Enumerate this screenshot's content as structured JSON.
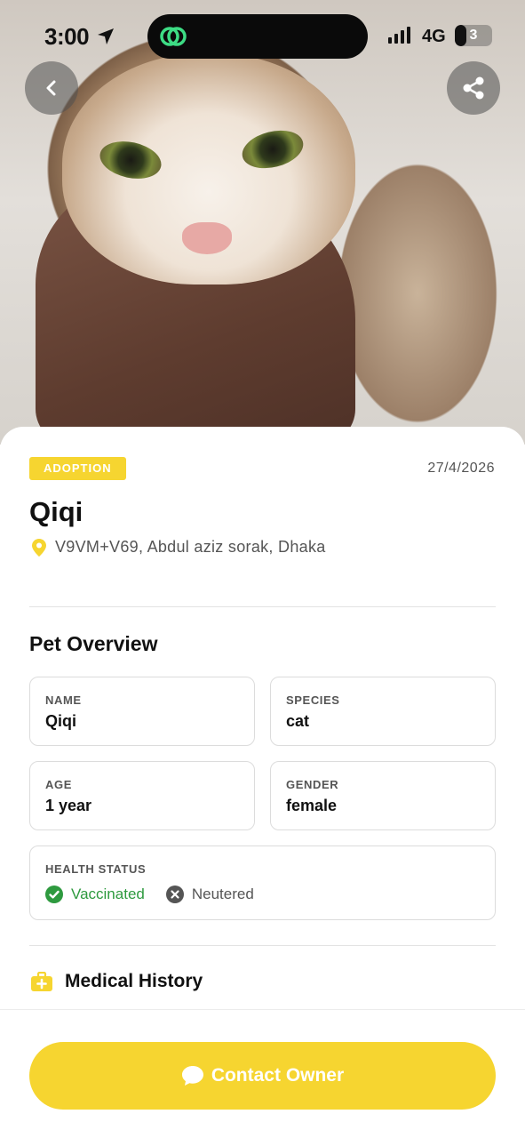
{
  "status_bar": {
    "time": "3:00",
    "network": "4G",
    "battery_level": "3",
    "battery_fraction": 0.3
  },
  "header": {
    "back_icon": "chevron-left-icon",
    "share_icon": "share-icon"
  },
  "listing": {
    "badge": "ADOPTION",
    "date": "27/4/2026",
    "name": "Qiqi",
    "location": "V9VM+V69, Abdul aziz sorak, Dhaka"
  },
  "overview": {
    "title": "Pet Overview",
    "name_label": "NAME",
    "name_value": "Qiqi",
    "species_label": "SPECIES",
    "species_value": "cat",
    "age_label": "AGE",
    "age_value": "1 year",
    "gender_label": "GENDER",
    "gender_value": "female",
    "health_label": "HEALTH STATUS",
    "health_items": [
      {
        "label": "Vaccinated",
        "status": true
      },
      {
        "label": "Neutered",
        "status": false
      }
    ]
  },
  "medical": {
    "title": "Medical History"
  },
  "footer": {
    "contact_label": "Contact Owner"
  },
  "colors": {
    "accent": "#f6d530",
    "success": "#2e9a3f",
    "muted": "#555555"
  }
}
